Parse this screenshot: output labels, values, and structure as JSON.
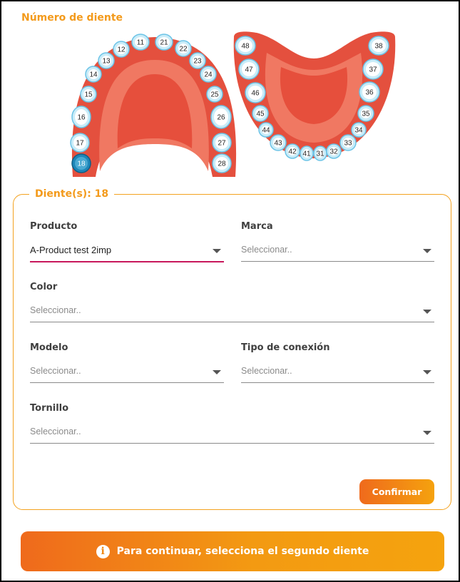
{
  "chart_title": "Número de diente",
  "upper_teeth": [
    "11",
    "12",
    "13",
    "14",
    "15",
    "16",
    "17",
    "18",
    "21",
    "22",
    "23",
    "24",
    "25",
    "26",
    "27",
    "28"
  ],
  "lower_teeth": [
    "31",
    "32",
    "33",
    "34",
    "35",
    "36",
    "37",
    "38",
    "41",
    "42",
    "43",
    "44",
    "45",
    "46",
    "47",
    "48"
  ],
  "selected_tooth": "18",
  "colors": {
    "accent": "#f39a1b",
    "selected_tooth": "#1f86b8",
    "gum": "#e4503e",
    "active_underline": "#c8175b"
  },
  "form": {
    "legend": "Diente(s): 18",
    "producto": {
      "label": "Producto",
      "value": "A-Product test 2imp"
    },
    "marca": {
      "label": "Marca",
      "placeholder": "Seleccionar.."
    },
    "color": {
      "label": "Color",
      "placeholder": "Seleccionar.."
    },
    "modelo": {
      "label": "Modelo",
      "placeholder": "Seleccionar.."
    },
    "tipo_conexion": {
      "label": "Tipo de conexión",
      "placeholder": "Seleccionar.."
    },
    "tornillo": {
      "label": "Tornillo",
      "placeholder": "Seleccionar.."
    },
    "confirm_label": "Confirmar"
  },
  "banner": {
    "icon": "info-icon",
    "text": "Para continuar, selecciona el segundo diente"
  }
}
